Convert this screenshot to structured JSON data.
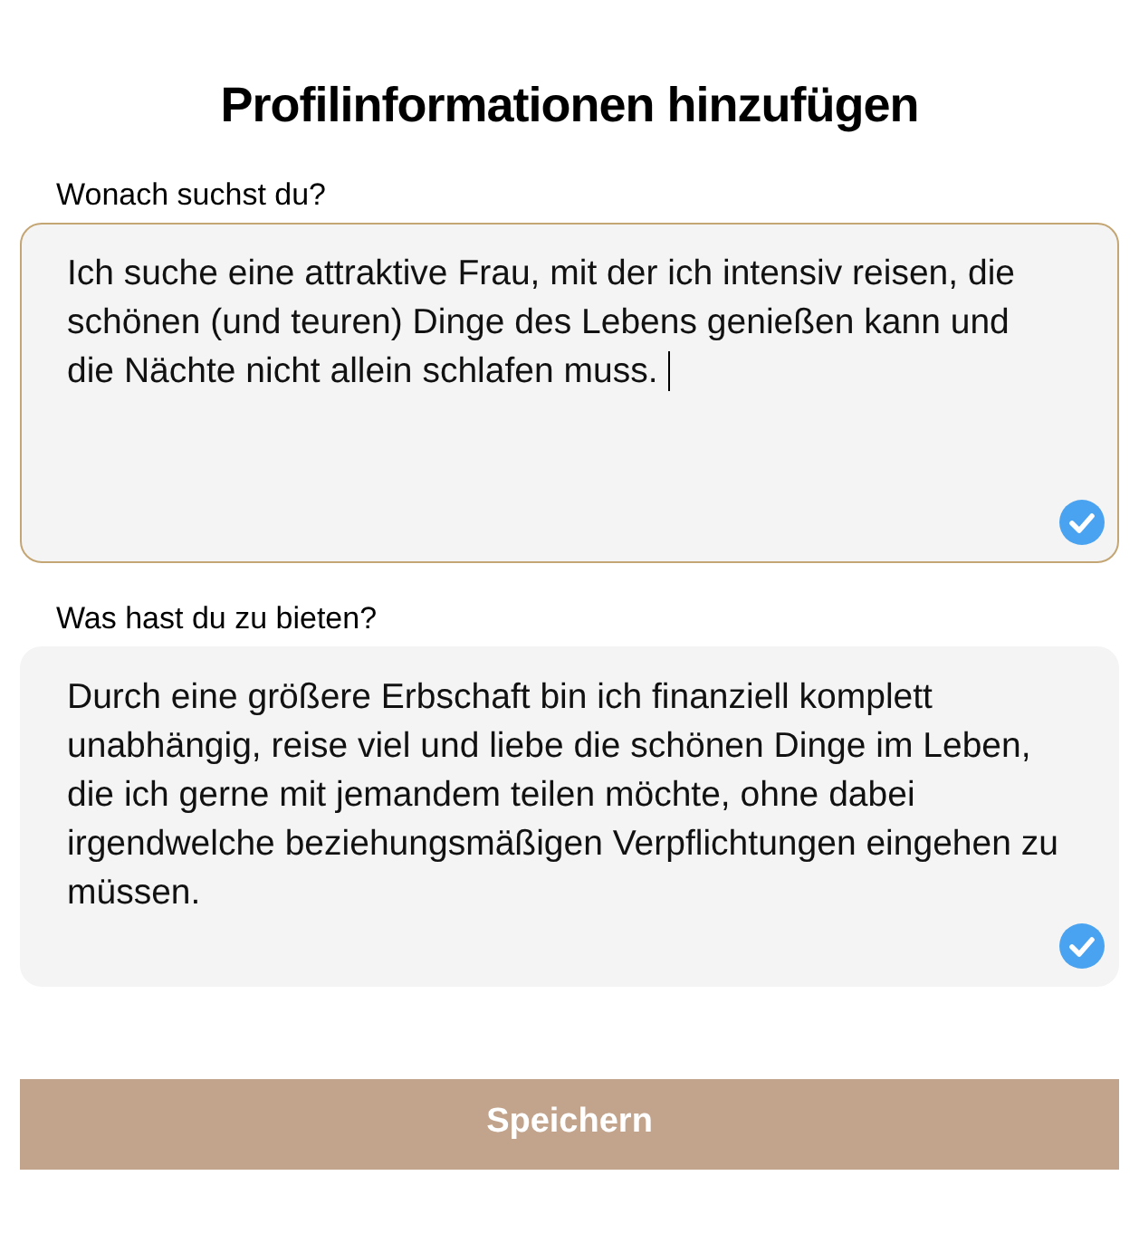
{
  "title": "Profilinformationen hinzufügen",
  "fields": [
    {
      "label": "Wonach suchst du?",
      "value": "Ich suche eine attraktive Frau, mit der ich intensiv reisen, die schönen (und teuren) Dinge des Lebens genießen kann und die Nächte nicht allein schlafen muss.",
      "focused": true,
      "valid": true
    },
    {
      "label": "Was hast du zu bieten?",
      "value": "Durch eine größere Erbschaft bin ich finanziell komplett unabhängig, reise viel und liebe die schönen Dinge im Leben, die ich gerne mit jemandem teilen möchte, ohne dabei irgendwelche beziehungsmäßigen Verpflichtungen eingehen zu müssen.",
      "focused": false,
      "valid": true
    }
  ],
  "button": "Speichern"
}
